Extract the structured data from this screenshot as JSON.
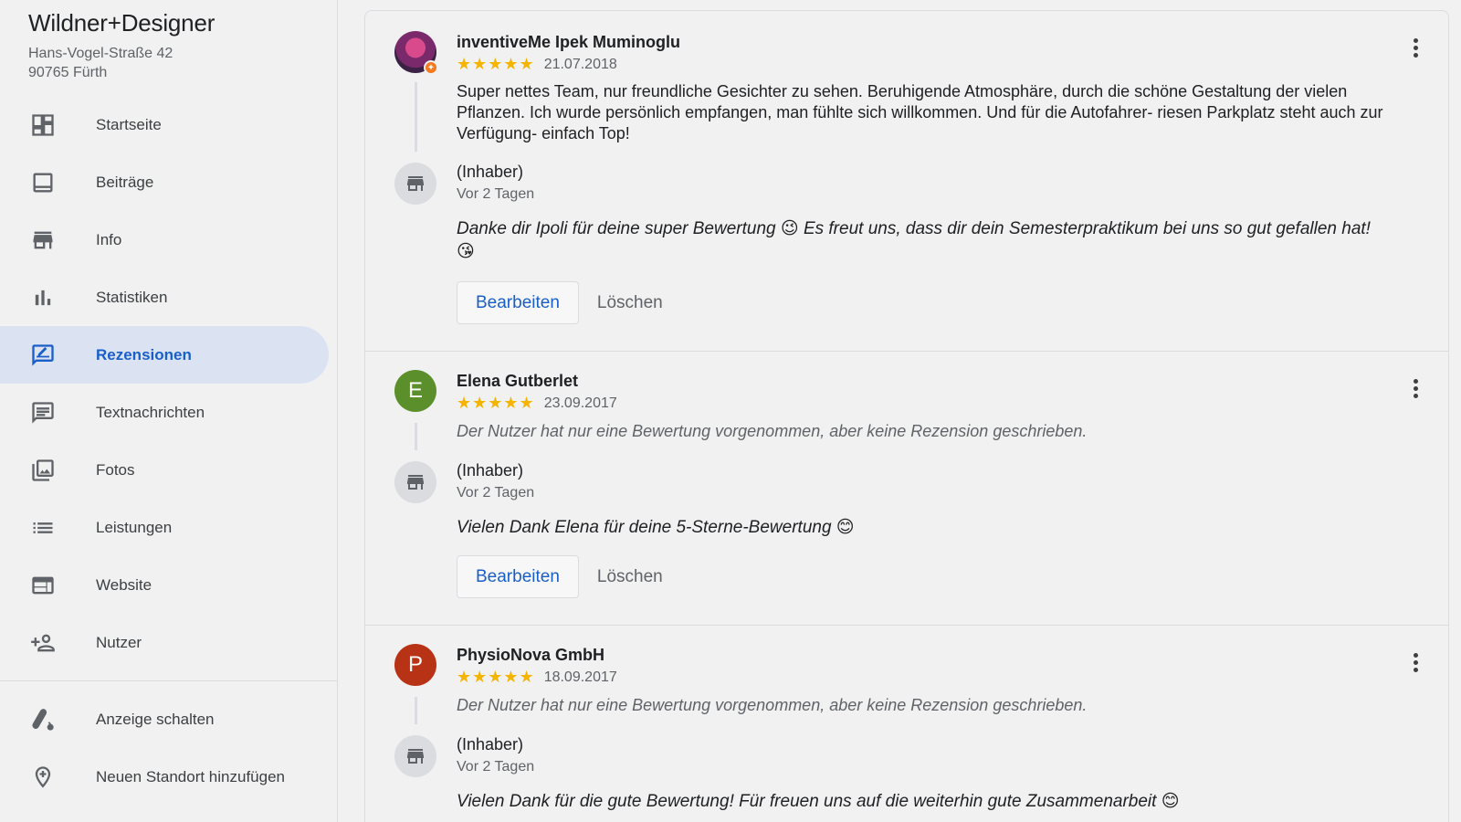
{
  "business": {
    "name": "Wildner+Designer",
    "address_line1": "Hans-Vogel-Straße 42",
    "address_line2": "90765 Fürth"
  },
  "sidebar": {
    "items": [
      {
        "label": "Startseite",
        "icon": "dashboard-icon"
      },
      {
        "label": "Beiträge",
        "icon": "posts-icon"
      },
      {
        "label": "Info",
        "icon": "storefront-icon"
      },
      {
        "label": "Statistiken",
        "icon": "bar-chart-icon"
      },
      {
        "label": "Rezensionen",
        "icon": "rate-review-icon",
        "active": true
      },
      {
        "label": "Textnachrichten",
        "icon": "message-icon"
      },
      {
        "label": "Fotos",
        "icon": "photo-library-icon"
      },
      {
        "label": "Leistungen",
        "icon": "list-icon"
      },
      {
        "label": "Website",
        "icon": "web-icon"
      },
      {
        "label": "Nutzer",
        "icon": "person-add-icon"
      }
    ],
    "secondary": [
      {
        "label": "Anzeige schalten",
        "icon": "google-ads-icon"
      },
      {
        "label": "Neuen Standort hinzufügen",
        "icon": "add-location-icon"
      }
    ]
  },
  "reviews": [
    {
      "reviewer": "inventiveMe Ipek Muminoglu",
      "stars": "★★★★★",
      "rating": 5,
      "date": "21.07.2018",
      "text": "Super nettes Team, nur freundliche Gesichter zu sehen. Beruhigende Atmosphäre, durch die schöne Gestaltung der vielen Pflanzen. Ich wurde persönlich empfangen, man fühlte sich willkommen. Und für die Autofahrer- riesen Parkplatz steht auch zur Verfügung- einfach Top!",
      "owner_label": "(Inhaber)",
      "owner_time": "Vor 2 Tagen",
      "reply": "Danke dir Ipoli für deine super Bewertung 😉 Es freut uns, dass dir dein Semesterpraktikum bei uns so gut gefallen hat! 😘"
    },
    {
      "reviewer": "Elena Gutberlet",
      "avatar_letter": "E",
      "avatar_color": "#5b8f2c",
      "stars": "★★★★★",
      "rating": 5,
      "date": "23.09.2017",
      "text": "Der Nutzer hat nur eine Bewertung vorgenommen, aber keine Rezension geschrieben.",
      "owner_label": "(Inhaber)",
      "owner_time": "Vor 2 Tagen",
      "reply": "Vielen Dank Elena für deine 5-Sterne-Bewertung 😊"
    },
    {
      "reviewer": "PhysioNova GmbH",
      "avatar_letter": "P",
      "avatar_color": "#b83216",
      "stars": "★★★★★",
      "rating": 5,
      "date": "18.09.2017",
      "text": "Der Nutzer hat nur eine Bewertung vorgenommen, aber keine Rezension geschrieben.",
      "owner_label": "(Inhaber)",
      "owner_time": "Vor 2 Tagen",
      "reply": "Vielen Dank für die gute Bewertung! Für freuen uns auf die weiterhin gute Zusammenarbeit 😊"
    }
  ],
  "actions": {
    "edit_label": "Bearbeiten",
    "delete_label": "Löschen"
  },
  "colors": {
    "accent": "#1a5fc8",
    "active_bg": "#dbe3f3",
    "star": "#f4b400"
  }
}
